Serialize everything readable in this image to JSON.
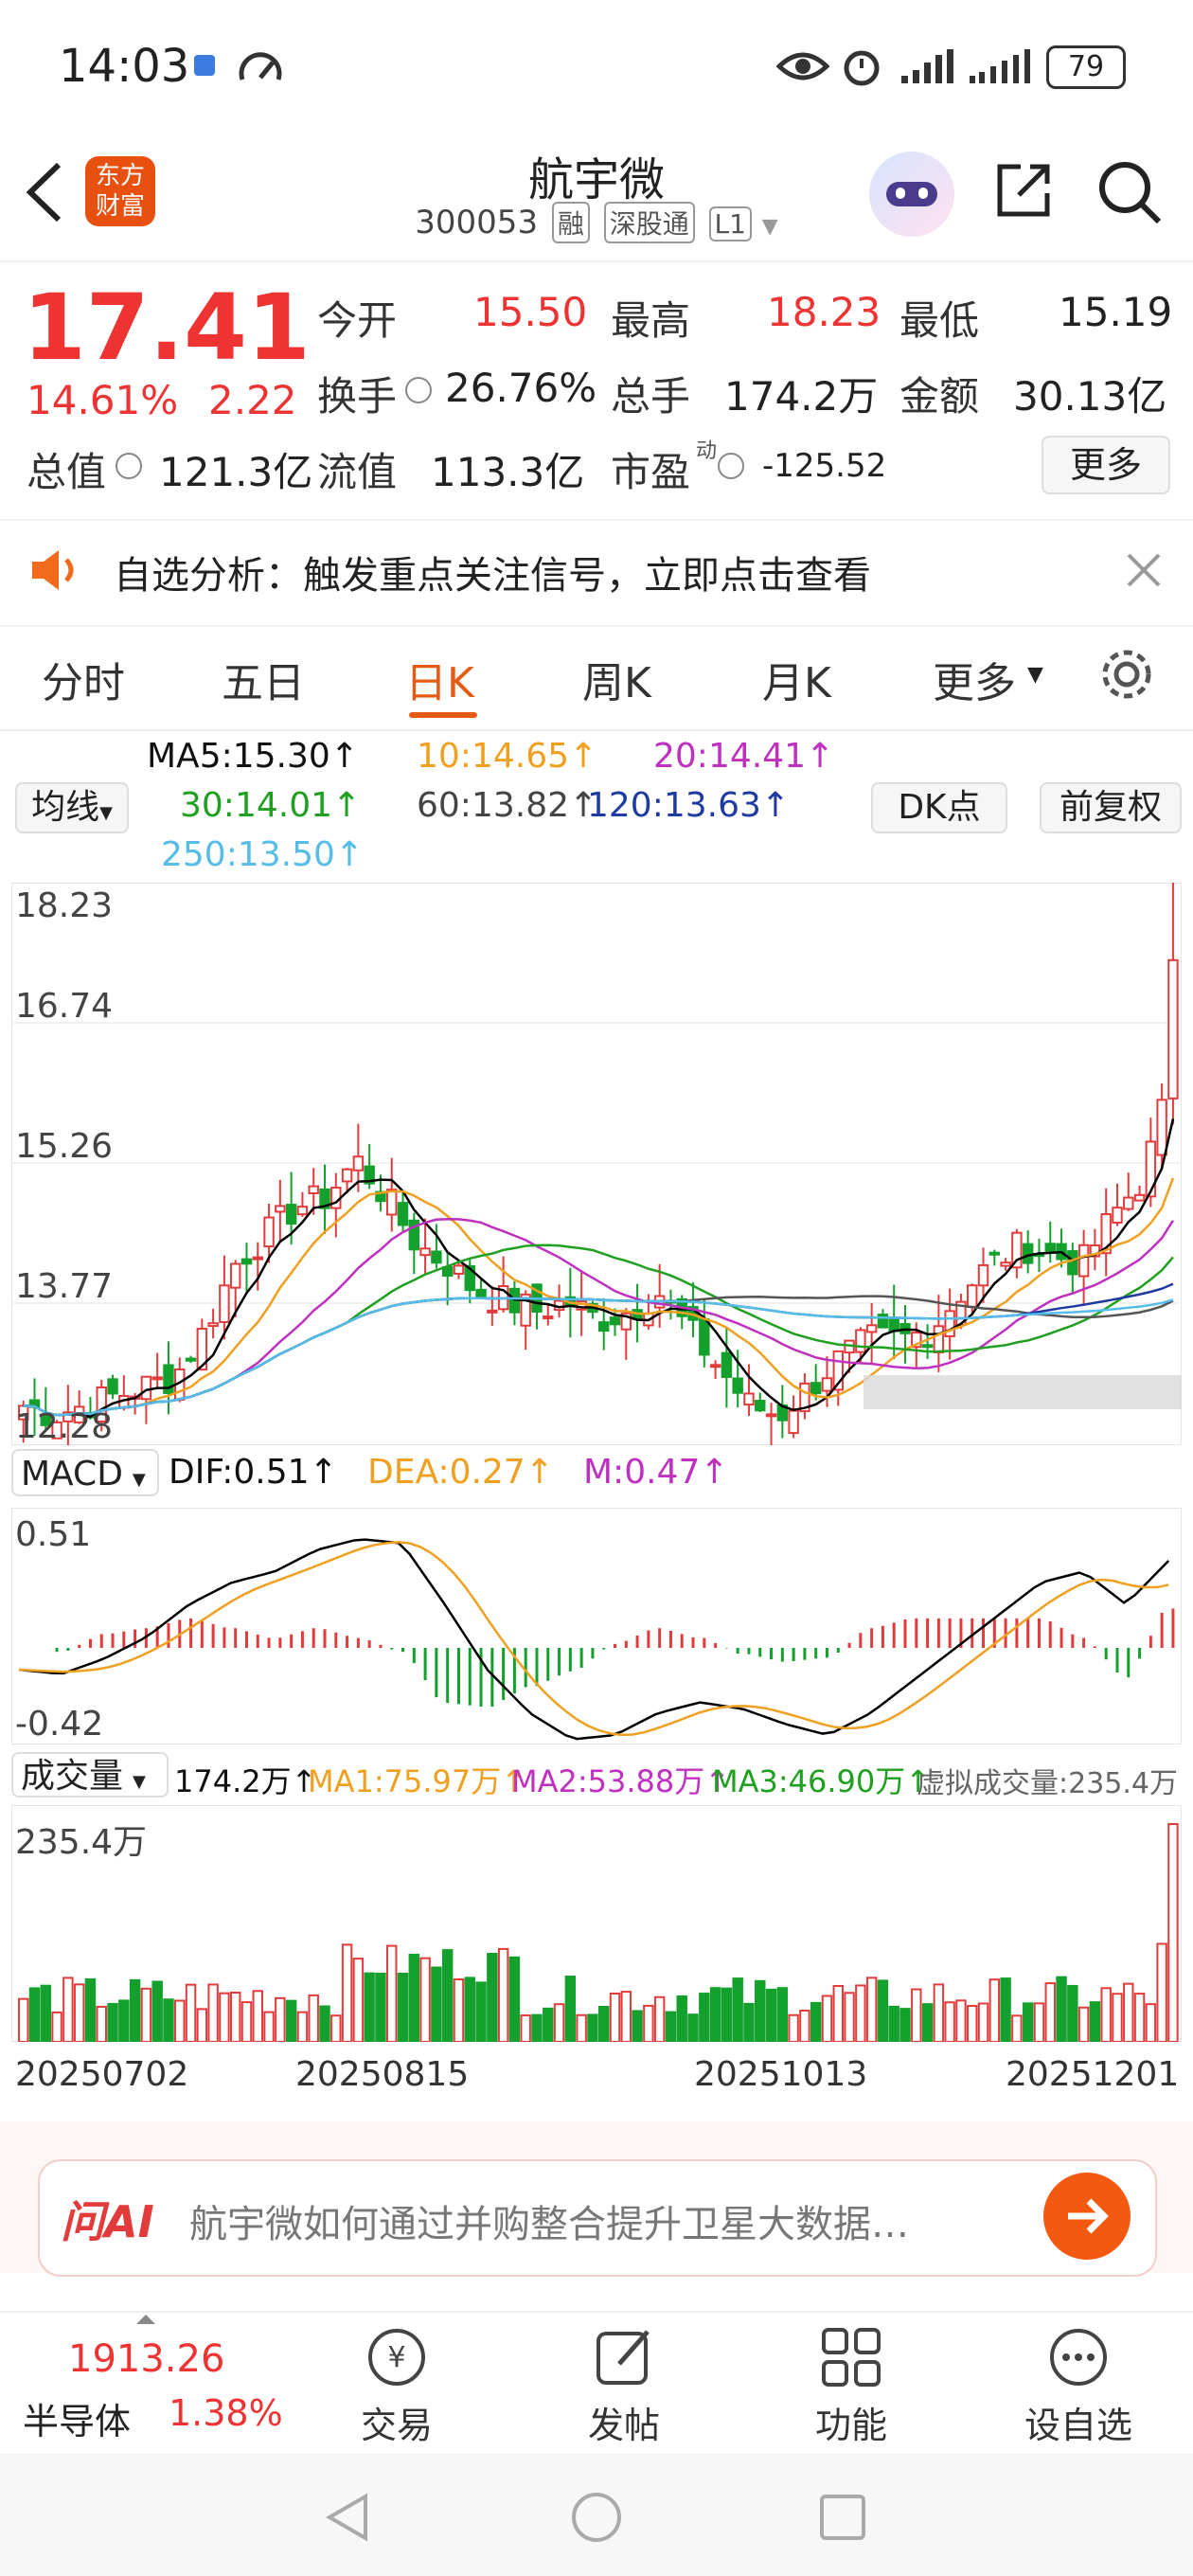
{
  "status_bar": {
    "time": "14:03",
    "battery": "79"
  },
  "header": {
    "title": "航宇微",
    "code": "300053",
    "tags": [
      "融",
      "深股通",
      "L1"
    ],
    "logo_line1": "东方",
    "logo_line2": "财富"
  },
  "quote": {
    "price": "17.41",
    "change_pct": "14.61%",
    "change_abs": "2.22",
    "open_label": "今开",
    "open": "15.50",
    "high_label": "最高",
    "high": "18.23",
    "low_label": "最低",
    "low": "15.19",
    "turnover_label": "换手",
    "turnover": "26.76%",
    "volume_label": "总手",
    "volume": "174.2万",
    "amount_label": "金额",
    "amount": "30.13亿",
    "mktcap_label": "总值",
    "mktcap": "121.3亿",
    "float_label": "流值",
    "float": "113.3亿",
    "pe_label": "市盈",
    "pe_sup": "动",
    "pe": "-125.52",
    "more_button": "更多"
  },
  "alert": {
    "text": "自选分析：触发重点关注信号，立即点击查看"
  },
  "tabs": [
    "分时",
    "五日",
    "日K",
    "周K",
    "月K",
    "更多"
  ],
  "indicators": {
    "ma_selector": "均线",
    "ma5": "MA5:15.30↑",
    "ma10": "10:14.65↑",
    "ma20": "20:14.41↑",
    "ma30": "30:14.01↑",
    "ma60": "60:13.82↑",
    "ma120": "120:13.63↑",
    "ma250": "250:13.50↑",
    "dk_button": "DK点",
    "fq_button": "前复权"
  },
  "price_axis": [
    "18.23",
    "16.74",
    "15.26",
    "13.77",
    "12.28"
  ],
  "macd": {
    "selector": "MACD",
    "dif": "DIF:0.51↑",
    "dea": "DEA:0.27↑",
    "m": "M:0.47↑",
    "top": "0.51",
    "bottom": "-0.42"
  },
  "volume_panel": {
    "selector": "成交量",
    "vol": "174.2万↑",
    "ma1": "MA1:75.97万↑",
    "ma2": "MA2:53.88万↑",
    "ma3": "MA3:46.90万↑",
    "virtual": "虚拟成交量:235.4万",
    "top": "235.4万"
  },
  "dates": [
    "20250702",
    "20250815",
    "20251013",
    "20251201"
  ],
  "ai_bar": {
    "logo": "问AI",
    "question": "航宇微如何通过并购整合提升卫星大数据…"
  },
  "bottom_bar": {
    "index_value": "1913.26",
    "index_name": "半导体",
    "index_pct": "1.38%",
    "items": [
      "交易",
      "发帖",
      "功能",
      "设自选"
    ]
  },
  "colors": {
    "up": "#e33b3b",
    "down": "#14a02c",
    "accent": "#e65a14",
    "ma5": "#000000",
    "ma10": "#f0a020",
    "ma20": "#c030c0",
    "ma30": "#20a020",
    "ma60": "#555555",
    "ma120": "#1f3aa0",
    "ma250": "#55bde8"
  },
  "chart_data": {
    "type": "candlestick",
    "price_range": [
      12.28,
      18.23
    ],
    "last_close": 17.41,
    "last_high": 18.23
  }
}
